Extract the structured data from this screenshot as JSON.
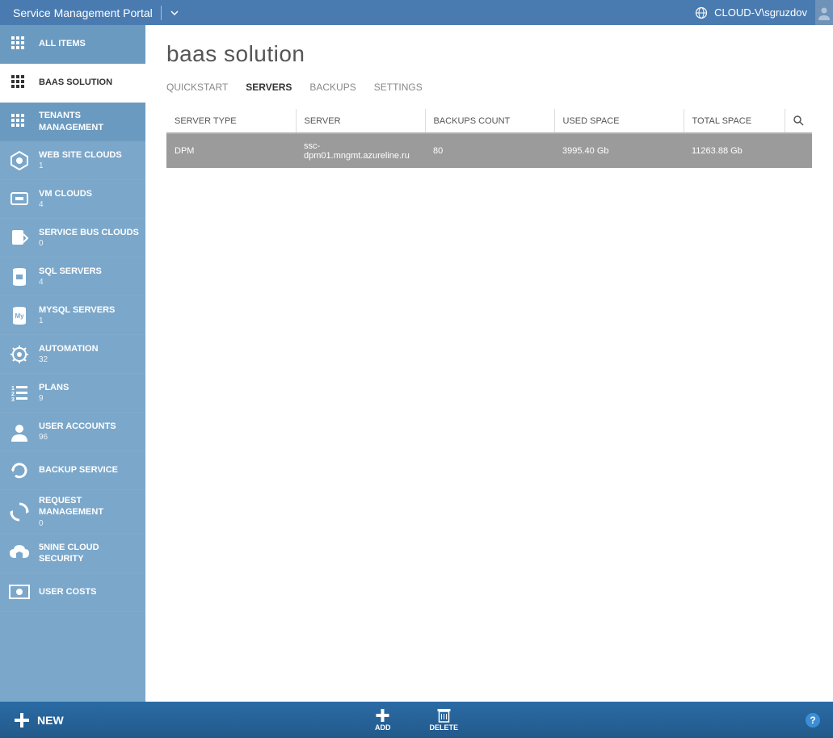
{
  "header": {
    "title": "Service Management Portal",
    "user": "CLOUD-V\\sgruzdov"
  },
  "sidebar": {
    "items": [
      {
        "label": "ALL ITEMS",
        "count": ""
      },
      {
        "label": "BAAS SOLUTION",
        "count": ""
      },
      {
        "label": "TENANTS MANAGEMENT",
        "count": ""
      },
      {
        "label": "WEB SITE CLOUDS",
        "count": "1"
      },
      {
        "label": "VM CLOUDS",
        "count": "4"
      },
      {
        "label": "SERVICE BUS CLOUDS",
        "count": "0"
      },
      {
        "label": "SQL SERVERS",
        "count": "4"
      },
      {
        "label": "MYSQL SERVERS",
        "count": "1"
      },
      {
        "label": "AUTOMATION",
        "count": "32"
      },
      {
        "label": "PLANS",
        "count": "9"
      },
      {
        "label": "USER ACCOUNTS",
        "count": "96"
      },
      {
        "label": "BACKUP SERVICE",
        "count": ""
      },
      {
        "label": "REQUEST MANAGEMENT",
        "count": "0"
      },
      {
        "label": "5NINE CLOUD SECURITY",
        "count": ""
      },
      {
        "label": "USER COSTS",
        "count": ""
      }
    ]
  },
  "main": {
    "title": "baas solution",
    "tabs": [
      {
        "label": "QUICKSTART"
      },
      {
        "label": "SERVERS"
      },
      {
        "label": "BACKUPS"
      },
      {
        "label": "SETTINGS"
      }
    ],
    "table": {
      "columns": [
        "SERVER TYPE",
        "SERVER",
        "BACKUPS COUNT",
        "USED SPACE",
        "TOTAL SPACE"
      ],
      "rows": [
        {
          "server_type": "DPM",
          "server": "ssc-dpm01.mngmt.azureline.ru",
          "backups_count": "80",
          "used_space": "3995.40 Gb",
          "total_space": "11263.88 Gb"
        }
      ]
    }
  },
  "bottom": {
    "new": "NEW",
    "add": "ADD",
    "delete": "DELETE"
  }
}
